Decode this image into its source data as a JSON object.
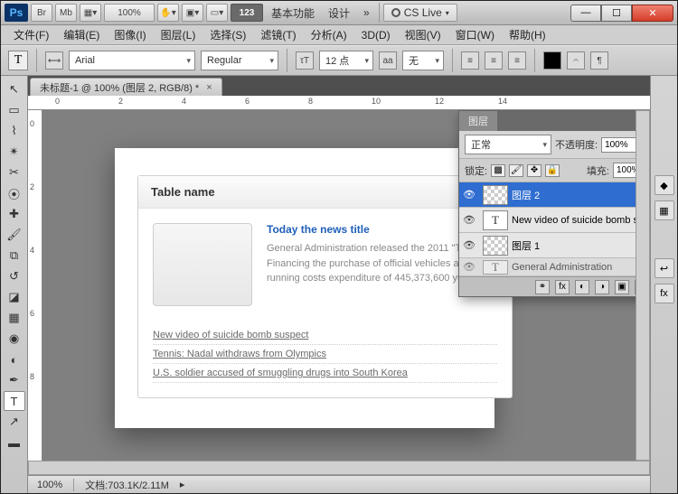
{
  "app": {
    "logo": "Ps",
    "zoom_display": "100%",
    "num_btn": "123",
    "tb_grp1": "基本功能",
    "tb_grp2": "设计",
    "cslive": "CS Live",
    "more": "»"
  },
  "menus": [
    "文件(F)",
    "编辑(E)",
    "图像(I)",
    "图层(L)",
    "选择(S)",
    "滤镜(T)",
    "分析(A)",
    "3D(D)",
    "视图(V)",
    "窗口(W)",
    "帮助(H)"
  ],
  "opt": {
    "font": "Arial",
    "weight": "Regular",
    "size": "12 点",
    "aa": "aa",
    "anti": "无"
  },
  "doc": {
    "tab": "未标题-1 @ 100% (图层 2, RGB/8) *"
  },
  "content": {
    "card_title": "Table name",
    "news_title": "Today the news title",
    "news_body": "General Administration released the 2011 \"Three Financing the purchase of official vehicles and running costs expenditure of 445,373,600 yuan,",
    "links": [
      "New video of suicide bomb suspect",
      "Tennis: Nadal withdraws from Olympics",
      "U.S. soldier accused of smuggling drugs into South Korea"
    ]
  },
  "layers_panel": {
    "title": "图层",
    "blend": "正常",
    "opacity_label": "不透明度:",
    "opacity": "100%",
    "lock_label": "锁定:",
    "fill_label": "填充:",
    "fill": "100%",
    "layers": [
      {
        "name": "图层 2",
        "type": "raster",
        "sel": true
      },
      {
        "name": "New video of suicide bomb s...",
        "type": "text",
        "sel": false
      },
      {
        "name": "图层 1",
        "type": "raster",
        "sel": false,
        "fx": true
      },
      {
        "name": "General Administration",
        "type": "text",
        "sel": false
      }
    ]
  },
  "status": {
    "zoom": "100%",
    "doc_label": "文档:",
    "doc_size": "703.1K/2.11M"
  },
  "ruler": {
    "h": [
      "0",
      "2",
      "4",
      "6",
      "8",
      "10",
      "12",
      "14"
    ],
    "v": [
      "0",
      "2",
      "4",
      "6",
      "8"
    ]
  }
}
